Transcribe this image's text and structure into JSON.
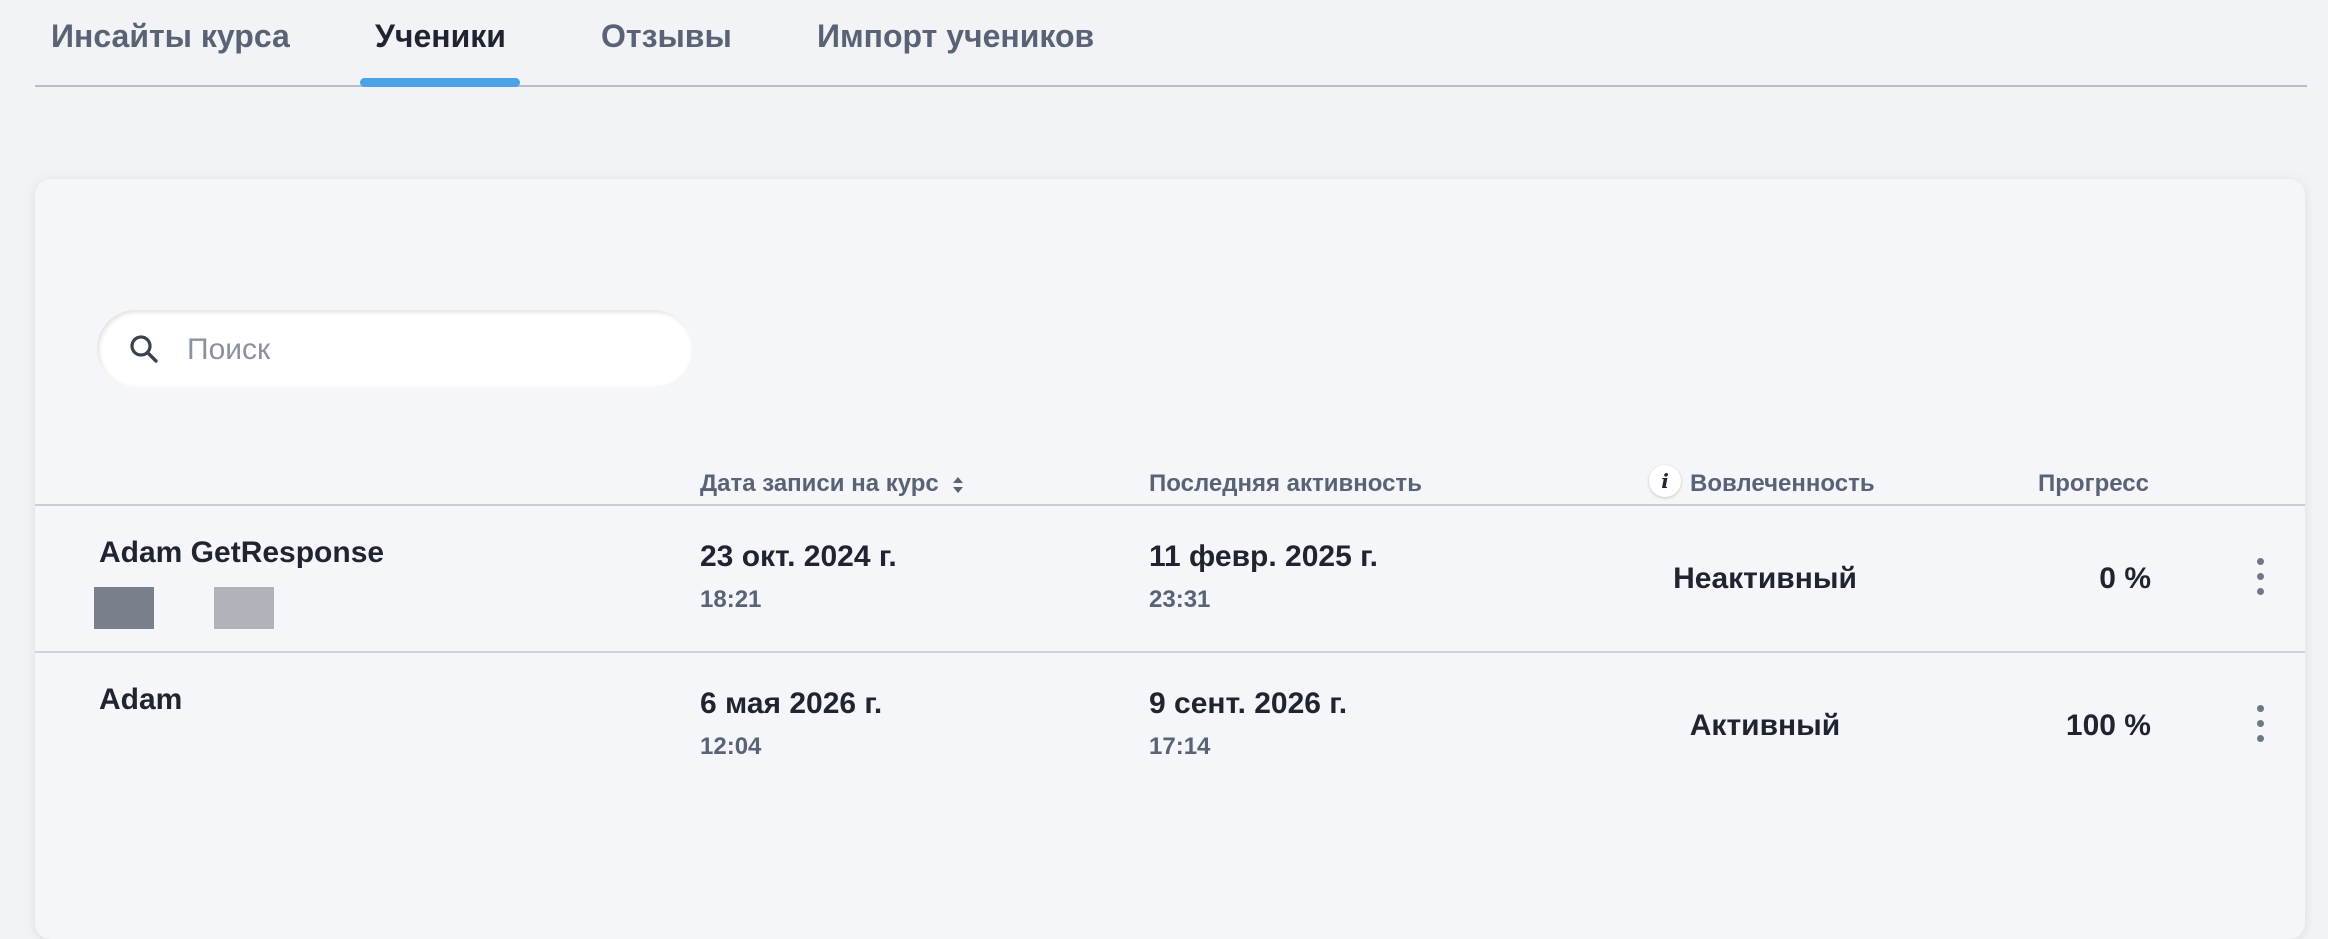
{
  "tabs": [
    {
      "label": "Инсайты курса",
      "active": false
    },
    {
      "label": "Ученики",
      "active": true
    },
    {
      "label": "Отзывы",
      "active": false
    },
    {
      "label": "Импорт учеников",
      "active": false
    }
  ],
  "search": {
    "placeholder": "Поиск",
    "value": ""
  },
  "table": {
    "columns": {
      "enrolled": "Дата записи на курс",
      "last_activity": "Последняя активность",
      "engagement": "Вовлеченность",
      "progress": "Прогресс"
    },
    "rows": [
      {
        "name": "Adam GetResponse",
        "enrolled_date": "23 окт. 2024 г.",
        "enrolled_time": "18:21",
        "last_date": "11 февр. 2025 г.",
        "last_time": "23:31",
        "engagement": "Неактивный",
        "progress": "0 %",
        "tags": [
          "#7a7f8c",
          "#b0b3ba"
        ]
      },
      {
        "name": "Adam",
        "enrolled_date": "6 мая 2026 г.",
        "enrolled_time": "12:04",
        "last_date": "9 сент. 2026 г.",
        "last_time": "17:14",
        "engagement": "Активный",
        "progress": "100 %",
        "tags": []
      }
    ]
  },
  "colors": {
    "accent": "#4aa3e6",
    "background": "#f2f3f7",
    "card": "#f5f6fa"
  },
  "icons": [
    "search-icon",
    "sort-icon",
    "info-icon",
    "kebab-menu-icon"
  ]
}
